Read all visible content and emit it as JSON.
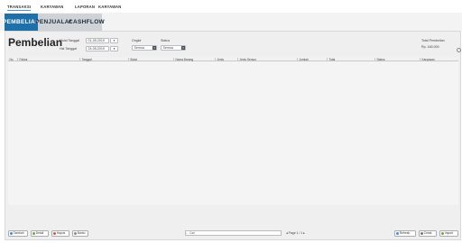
{
  "menu": {
    "items": [
      "TRANSAKSI",
      "KARYAWAN",
      "LAPORAN",
      "KARYAWAN"
    ]
  },
  "tabs": [
    "PEMBELIAN",
    "PENJUALAN",
    "CASHFLOW"
  ],
  "page": {
    "title": "Pembelian"
  },
  "filters": {
    "date_from_label": "Mulai Tanggal",
    "date_from_value": "01-05-2019",
    "date_to_label": "Hst Tanggal",
    "date_to_value": "24-05-2019",
    "cal_btn": "▾",
    "ongkir_label": "Ongkir",
    "ongkir_value": "Semua",
    "status_label": "Status",
    "status_value": "Semua"
  },
  "total": {
    "label": "Total Pembelian",
    "value": "Rp. 160.000"
  },
  "table": {
    "headers": [
      "No",
      "Faktur",
      "Tanggal",
      "Bulat",
      "Nama Barang",
      "Jenis",
      "Jenis Sensor",
      "Jumlah",
      "Total",
      "Status",
      "Karyawan"
    ]
  },
  "footer": {
    "buttons_left": [
      "Tambah",
      "Detail",
      "Hapus",
      "Bantu"
    ],
    "search_placeholder": "Cari",
    "pager_text": "Page 1 / 1",
    "buttons_right": [
      "Refresh",
      "Cetak",
      "Import"
    ]
  },
  "colors": {
    "accent": "#1f6fa8",
    "panel": "#efeff0"
  }
}
